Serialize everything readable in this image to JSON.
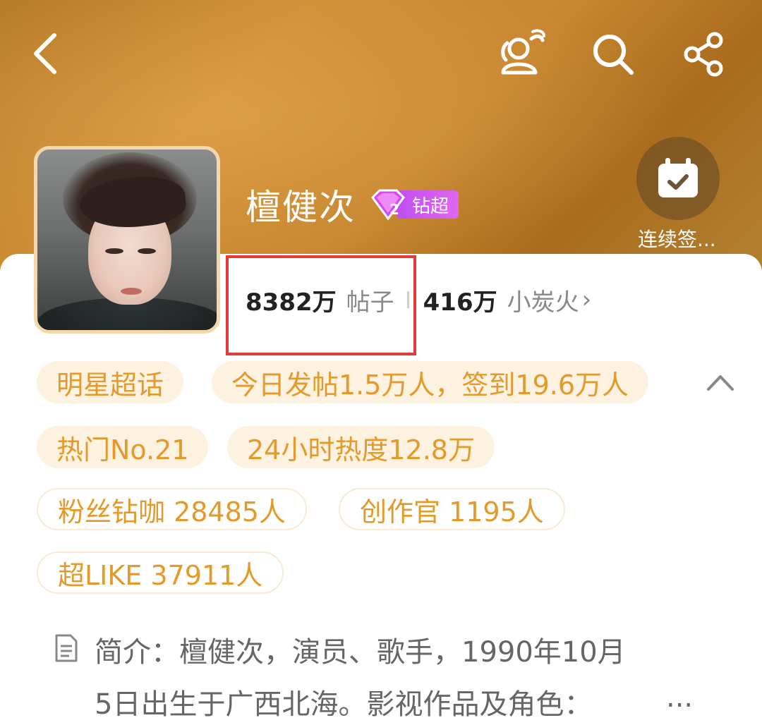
{
  "header": {
    "back_icon": "chevron-left-icon",
    "people_icon": "super-topic-people-icon",
    "search_icon": "search-icon",
    "share_icon": "share-icon"
  },
  "profile": {
    "name": "檀健次",
    "badge_level": "2",
    "badge_label": "钻超",
    "checkin_label": "连续签..."
  },
  "stats": {
    "posts_count": "8382万",
    "posts_label": "帖子",
    "fire_count": "416万",
    "fire_label": "小炭火",
    "fire_chevron": "›"
  },
  "tags": {
    "category": "明星超话",
    "today": "今日发帖1.5万人，签到19.6万人",
    "hot_rank": "热门No.21",
    "heat_24h": "24小时热度12.8万",
    "fans_diamond": "粉丝钻咖 28485人",
    "creators": "创作官 1195人",
    "super_like": "超LIKE 37911人"
  },
  "intro": {
    "line1": "简介：檀健次，演员、歌手，1990年10月",
    "line2": "5日出生于广西北海。影视作品及角色：",
    "more": "..."
  },
  "colors": {
    "header_gradient_start": "#b57a26",
    "tag_text": "#e39a2a",
    "tag_bg": "#fdf2e0",
    "badge_purple": "#c04ef2",
    "highlight_red": "#e53a3a"
  }
}
